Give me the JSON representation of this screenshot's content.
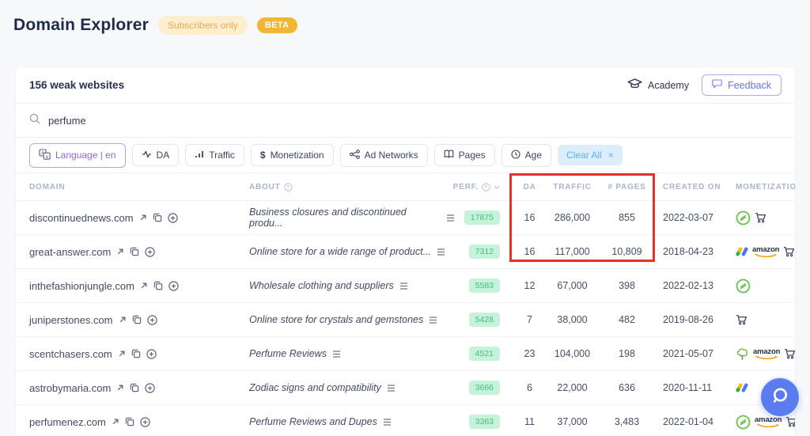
{
  "page": {
    "title": "Domain Explorer",
    "subscribers_badge": "Subscribers only",
    "beta_badge": "BETA"
  },
  "panel": {
    "header": "156 weak websites",
    "academy_label": "Academy",
    "feedback_label": "Feedback",
    "search": {
      "value": "perfume"
    }
  },
  "filters": [
    {
      "label": "Language | en",
      "icon": "language-icon",
      "state": "active"
    },
    {
      "label": "DA",
      "icon": "pulse-icon"
    },
    {
      "label": "Traffic",
      "icon": "bar-chart-icon"
    },
    {
      "label": "Monetization",
      "icon": "dollar-icon"
    },
    {
      "label": "Ad Networks",
      "icon": "share-icon"
    },
    {
      "label": "Pages",
      "icon": "book-icon"
    },
    {
      "label": "Age",
      "icon": "clock-icon"
    },
    {
      "label": "Clear All",
      "icon": "close-icon",
      "state": "clear",
      "close_glyph": "×"
    }
  ],
  "table": {
    "columns": [
      "Domain",
      "About",
      "Perf.",
      "DA",
      "Traffic",
      "# Pages",
      "Created on",
      "Monetization"
    ],
    "rows": [
      {
        "domain": "discontinuednews.com",
        "about": "Business closures and discontinued produ...",
        "perf": "17875",
        "da": "16",
        "traffic": "286,000",
        "pages": "855",
        "created": "2022-03-07",
        "monetization": [
          "ezoic",
          "cart"
        ]
      },
      {
        "domain": "great-answer.com",
        "about": "Online store for a wide range of product...",
        "perf": "7312",
        "da": "16",
        "traffic": "117,000",
        "pages": "10,809",
        "created": "2018-04-23",
        "monetization": [
          "adsense",
          "amazon",
          "cart"
        ]
      },
      {
        "domain": "inthefashionjungle.com",
        "about": "Wholesale clothing and suppliers",
        "perf": "5583",
        "da": "12",
        "traffic": "67,000",
        "pages": "398",
        "created": "2022-02-13",
        "monetization": [
          "ezoic"
        ]
      },
      {
        "domain": "juniperstones.com",
        "about": "Online store for crystals and gemstones",
        "perf": "5428",
        "da": "7",
        "traffic": "38,000",
        "pages": "482",
        "created": "2019-08-26",
        "monetization": [
          "cart"
        ]
      },
      {
        "domain": "scentchasers.com",
        "about": "Perfume Reviews",
        "perf": "4521",
        "da": "23",
        "traffic": "104,000",
        "pages": "198",
        "created": "2021-05-07",
        "monetization": [
          "tree",
          "amazon",
          "cart"
        ]
      },
      {
        "domain": "astrobymaria.com",
        "about": "Zodiac signs and compatibility",
        "perf": "3666",
        "da": "6",
        "traffic": "22,000",
        "pages": "636",
        "created": "2020-11-11",
        "monetization": [
          "adsense"
        ]
      },
      {
        "domain": "perfumenez.com",
        "about": "Perfume Reviews and Dupes",
        "perf": "3363",
        "da": "11",
        "traffic": "37,000",
        "pages": "3,483",
        "created": "2022-01-04",
        "monetization": [
          "ezoic",
          "amazon",
          "cart"
        ]
      }
    ]
  },
  "colors": {
    "accent_purple": "#6a70f2",
    "highlight_red": "#e53226",
    "perf_badge_bg": "#c5f3d9",
    "perf_badge_text": "#43bd84",
    "chat_blue": "#5b7cf0",
    "beta_badge_bg": "#f2b635",
    "subscribers_badge_text": "#f6a94a"
  }
}
